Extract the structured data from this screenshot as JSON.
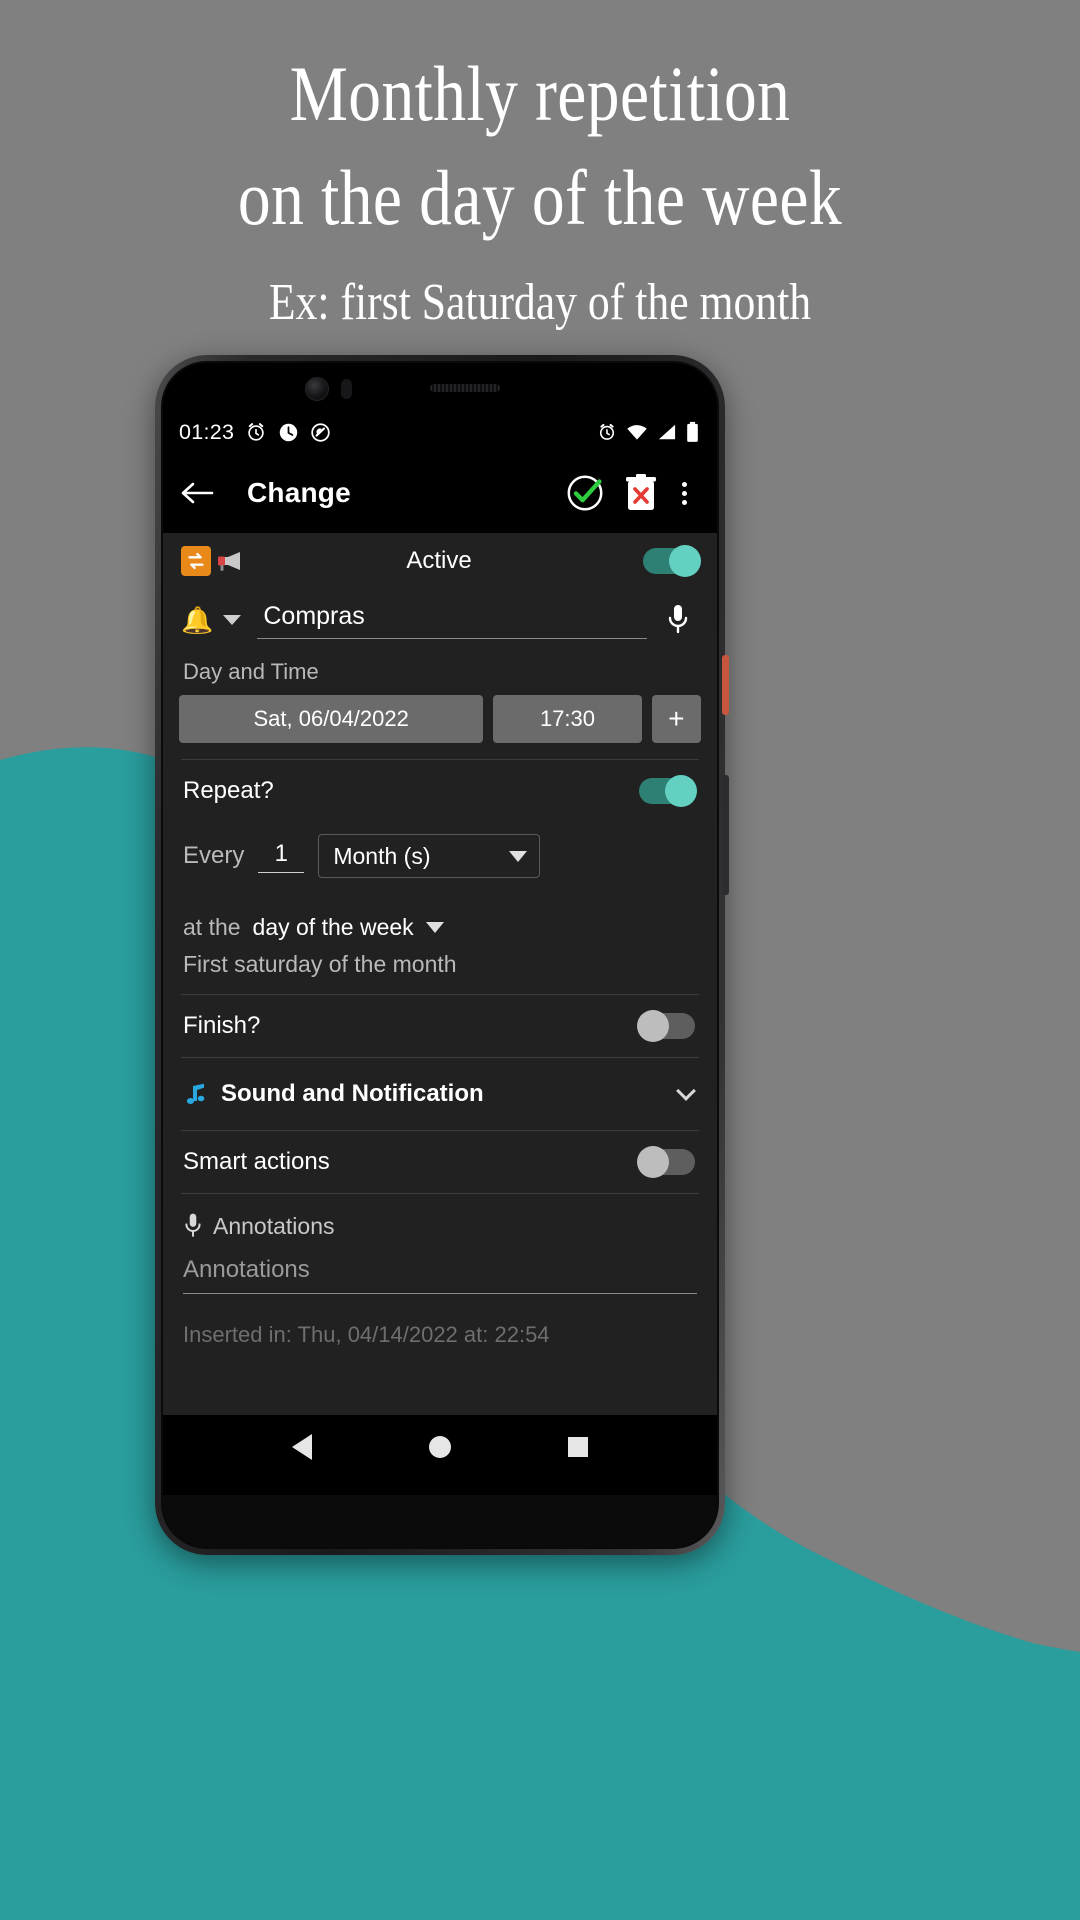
{
  "poster": {
    "headline_line1": "Monthly repetition",
    "headline_line2": "on the day of the week",
    "subtitle": "Ex: first Saturday of the month",
    "background_color": "#808080",
    "accent_color": "#2a9d9d",
    "text_color": "#ffffff"
  },
  "status_bar": {
    "time": "01:23",
    "left_icons": [
      "alarm-icon",
      "clock-icon",
      "do-not-disturb-icon"
    ],
    "right_icons": [
      "alarm-icon",
      "wifi-icon",
      "cellular-signal-icon",
      "battery-icon"
    ]
  },
  "toolbar": {
    "back_label": "←",
    "title": "Change",
    "save_icon": "check-circle-icon",
    "delete_icon": "delete-trash-icon",
    "overflow_icon": "overflow-menu-icon",
    "save_color": "#2ecc3f",
    "delete_color": "#e53935"
  },
  "form": {
    "active_label": "Active",
    "active_enabled": true,
    "repeat_badge_icon": "repeat-icon",
    "megaphone_icon": "megaphone-icon",
    "bell_icon": "bell-icon",
    "title_value": "Compras",
    "mic_icon": "microphone-icon",
    "day_time_label": "Day and Time",
    "date_chip": "Sat, 06/04/2022",
    "time_chip": "17:30",
    "add_chip": "+",
    "repeat_label": "Repeat?",
    "repeat_enabled": true,
    "every_label": "Every",
    "every_value": "1",
    "unit_value": "Month (s)",
    "at_the_label": "at the",
    "at_the_value": "day of the week",
    "at_the_description": "First saturday of the month",
    "finish_label": "Finish?",
    "finish_enabled": false,
    "sound_label": "Sound and Notification",
    "sound_icon": "music-note-icon",
    "sound_icon_color": "#29A8E0",
    "sound_expand_icon": "chevron-down-icon",
    "smart_actions_label": "Smart actions",
    "smart_actions_enabled": false,
    "annotations_header": "Annotations",
    "annotations_placeholder": "Annotations",
    "annotations_icon": "microphone-icon",
    "inserted_text": "Inserted in: Thu, 04/14/2022 at: 22:54"
  },
  "navbar": {
    "back": "nav-back-triangle-icon",
    "home": "nav-home-circle-icon",
    "recents": "nav-recents-square-icon"
  }
}
